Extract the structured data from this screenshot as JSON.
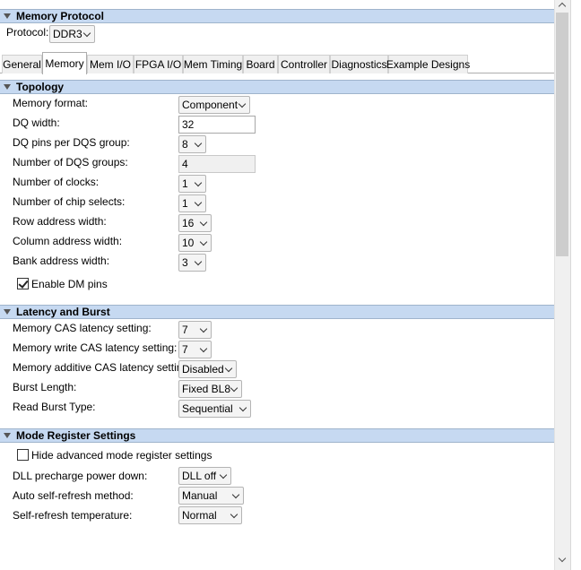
{
  "protocol_section": {
    "title": "Memory Protocol",
    "protocol_label": "Protocol:",
    "protocol_value": "DDR3"
  },
  "tabs": [
    "General",
    "Memory",
    "Mem I/O",
    "FPGA I/O",
    "Mem Timing",
    "Board",
    "Controller",
    "Diagnostics",
    "Example Designs"
  ],
  "active_tab": "Memory",
  "topology": {
    "title": "Topology",
    "memory_format": {
      "label": "Memory format:",
      "value": "Component"
    },
    "dq_width": {
      "label": "DQ width:",
      "value": "32"
    },
    "dq_pins_per_dqs": {
      "label": "DQ pins per DQS group:",
      "value": "8"
    },
    "num_dqs_groups": {
      "label": "Number of DQS groups:",
      "value": "4"
    },
    "num_clocks": {
      "label": "Number of clocks:",
      "value": "1"
    },
    "num_chip_selects": {
      "label": "Number of chip selects:",
      "value": "1"
    },
    "row_address_width": {
      "label": "Row address width:",
      "value": "16"
    },
    "column_address_width": {
      "label": "Column address width:",
      "value": "10"
    },
    "bank_address_width": {
      "label": "Bank address width:",
      "value": "3"
    },
    "enable_dm_pins": {
      "label": "Enable DM pins",
      "checked": true
    }
  },
  "latency": {
    "title": "Latency and Burst",
    "cas_latency": {
      "label": "Memory CAS latency setting:",
      "value": "7"
    },
    "write_cas_latency": {
      "label": "Memory write CAS latency setting:",
      "value": "7"
    },
    "additive_cas_latency": {
      "label": "Memory additive CAS latency setting:",
      "value": "Disabled"
    },
    "burst_length": {
      "label": "Burst Length:",
      "value": "Fixed BL8"
    },
    "read_burst_type": {
      "label": "Read Burst Type:",
      "value": "Sequential"
    }
  },
  "mode_register": {
    "title": "Mode Register Settings",
    "hide_advanced": {
      "label": "Hide advanced mode register settings",
      "checked": false
    },
    "dll_precharge": {
      "label": "DLL precharge power down:",
      "value": "DLL off"
    },
    "auto_self_refresh": {
      "label": "Auto self-refresh method:",
      "value": "Manual"
    },
    "self_refresh_temp": {
      "label": "Self-refresh temperature:",
      "value": "Normal"
    }
  }
}
